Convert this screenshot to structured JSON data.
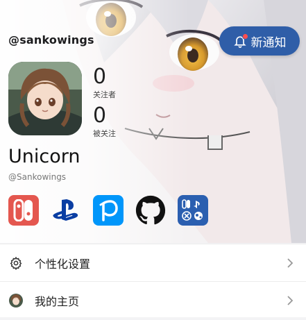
{
  "profile": {
    "username": "@sankowings",
    "display_name": "Unicorn",
    "handle": "@Sankowings",
    "following_count": "0",
    "following_label": "关注者",
    "followers_count": "0",
    "followers_label": "被关注"
  },
  "notify_button": {
    "label": "新通知",
    "icon": "bell-icon",
    "has_badge": true,
    "color": "#2f5ea8"
  },
  "platforms": [
    {
      "name": "nintendo-switch-icon",
      "color": "#e4574f"
    },
    {
      "name": "playstation-icon",
      "color": "#0a3ea3"
    },
    {
      "name": "pixiv-icon",
      "color": "#0096fa"
    },
    {
      "name": "github-icon",
      "color": "#111111"
    },
    {
      "name": "game-platforms-icon",
      "color": "#2b5fb0"
    }
  ],
  "menu": [
    {
      "label": "个性化设置",
      "icon": "gear-icon"
    },
    {
      "label": "我的主页",
      "icon": "avatar-icon"
    }
  ]
}
